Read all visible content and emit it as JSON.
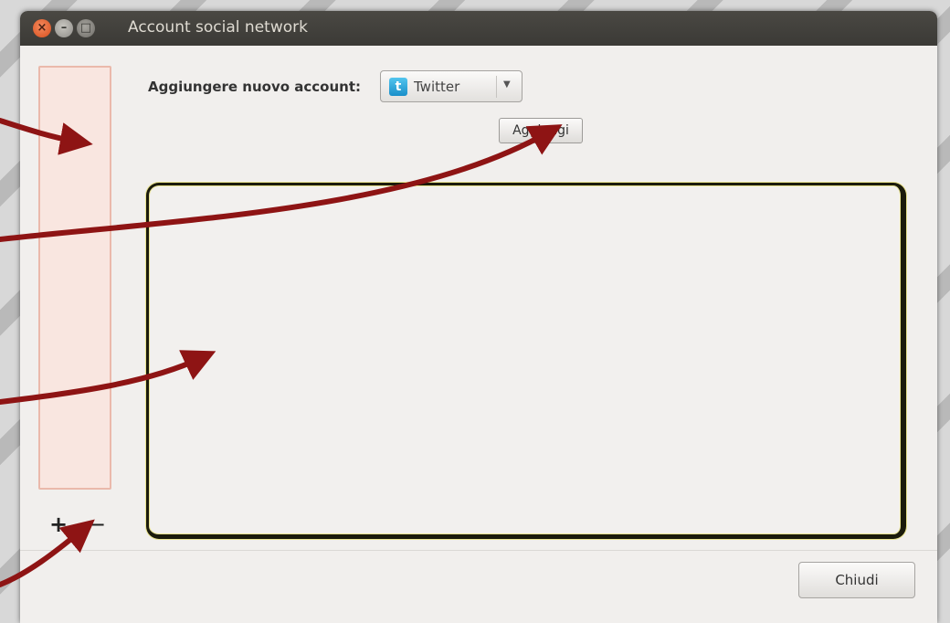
{
  "window": {
    "title": "Account social network"
  },
  "form": {
    "account_label": "Aggiungere nuovo account:",
    "network_select": {
      "icon": "twitter-icon",
      "icon_glyph": "t",
      "value": "Twitter"
    },
    "add_button": "Aggiungi"
  },
  "account_list": {
    "add_control": "+",
    "remove_control": "−"
  },
  "footer": {
    "close_button": "Chiudi"
  },
  "colors": {
    "annotation_arrow": "#8e1414",
    "list_highlight": "#f9e6e0",
    "twitter_blue": "#1a8fc9"
  }
}
